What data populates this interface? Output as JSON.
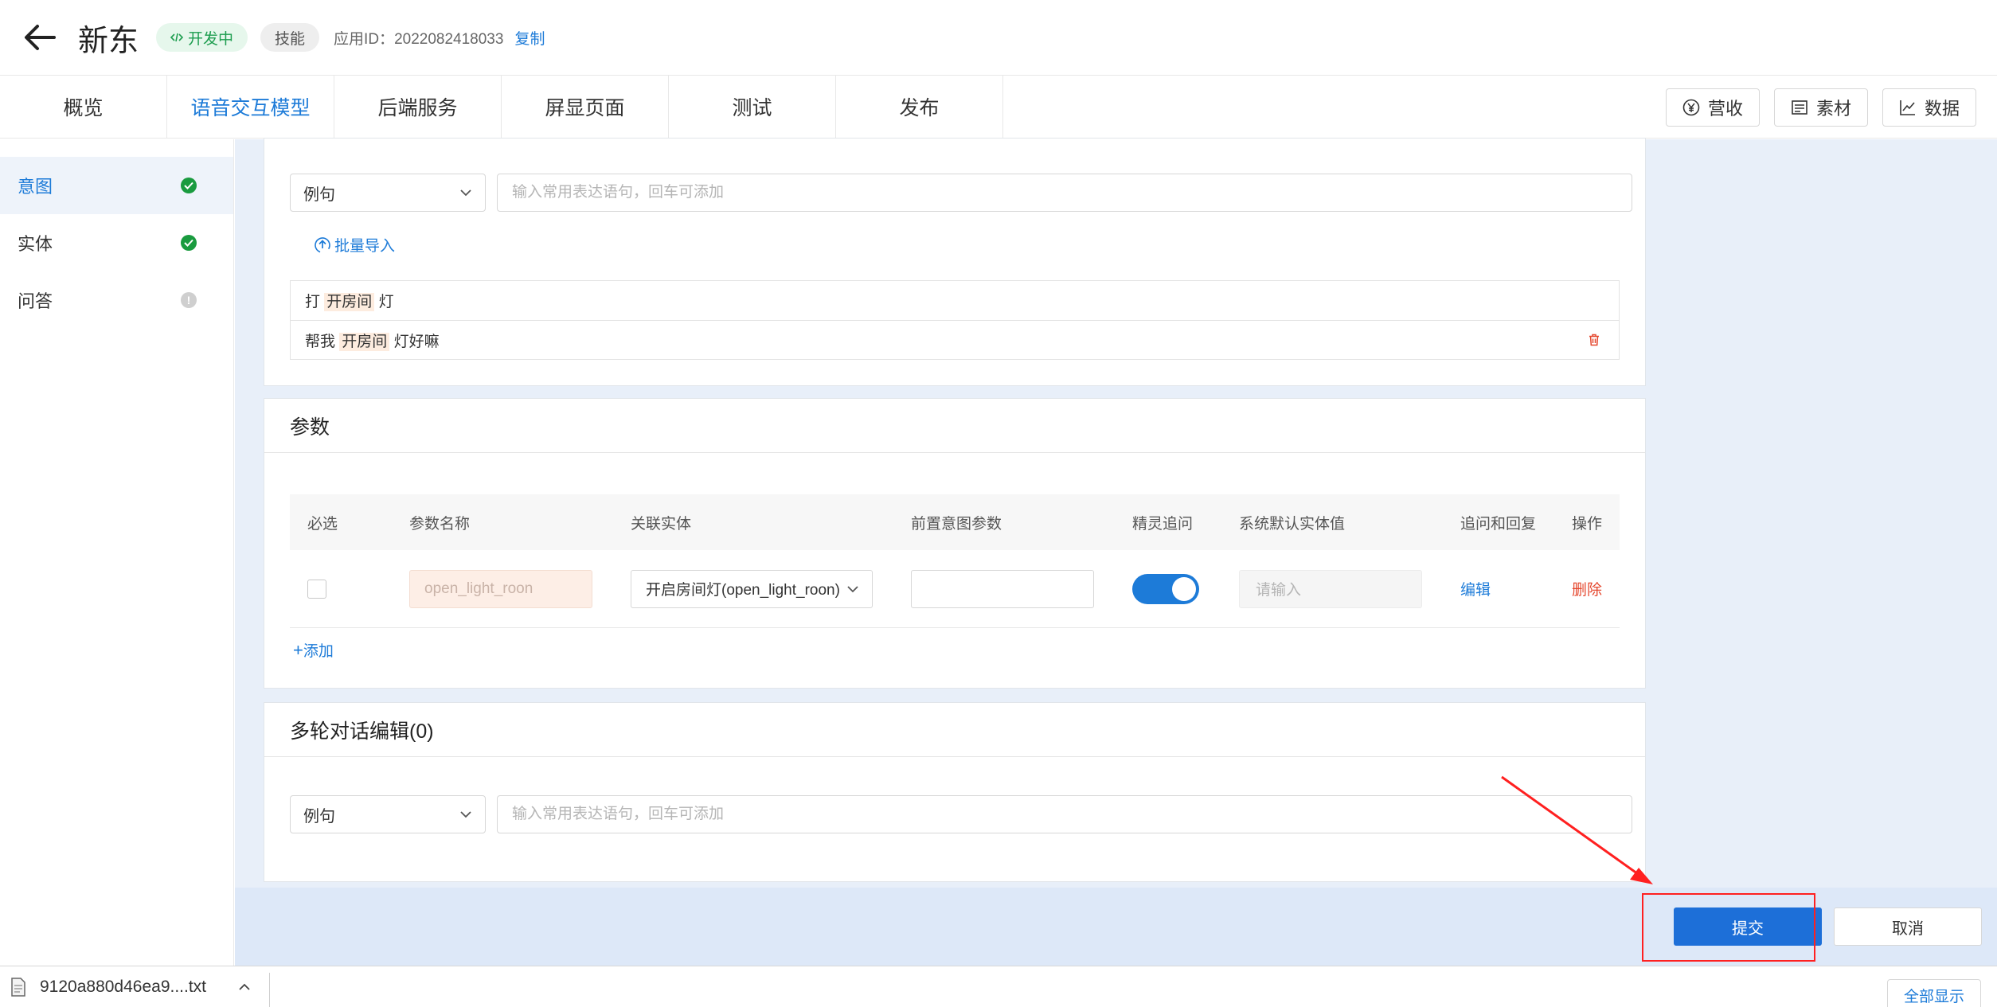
{
  "header": {
    "title": "新东",
    "status": "开发中",
    "type": "技能",
    "app_id_label": "应用ID：",
    "app_id": "2022082418033",
    "copy_label": "复制"
  },
  "tabs": [
    {
      "label": "概览",
      "active": false
    },
    {
      "label": "语音交互模型",
      "active": true
    },
    {
      "label": "后端服务",
      "active": false
    },
    {
      "label": "屏显页面",
      "active": false
    },
    {
      "label": "测试",
      "active": false
    },
    {
      "label": "发布",
      "active": false
    }
  ],
  "toolbar": {
    "revenue": "营收",
    "assets": "素材",
    "data": "数据"
  },
  "sidebar": {
    "items": [
      {
        "label": "意图",
        "state": "done"
      },
      {
        "label": "实体",
        "state": "done"
      },
      {
        "label": "问答",
        "state": "pending"
      }
    ]
  },
  "examples": {
    "select_value": "例句",
    "input_placeholder": "输入常用表达语句，回车可添加",
    "import_label": "批量导入",
    "rows": [
      {
        "pre": "打 ",
        "hl": "开房间",
        "post": " 灯"
      },
      {
        "pre": "帮我 ",
        "hl": "开房间",
        "post": " 灯好嘛"
      }
    ]
  },
  "params": {
    "title": "参数",
    "headers": {
      "required": "必选",
      "name": "参数名称",
      "entity": "关联实体",
      "prev": "前置意图参数",
      "wizard": "精灵追问",
      "default": "系统默认实体值",
      "reply": "追问和回复",
      "op": "操作"
    },
    "row": {
      "name": "open_light_roon",
      "entity": "开启房间灯(open_light_roon)",
      "default_placeholder": "请输入",
      "edit": "编辑",
      "delete": "删除"
    },
    "add_label": "添加"
  },
  "multiturn": {
    "title": "多轮对话编辑(0)",
    "select_value": "例句",
    "input_placeholder": "输入常用表达语句，回车可添加"
  },
  "actions": {
    "submit": "提交",
    "cancel": "取消"
  },
  "downloads": {
    "file": "9120a880d46ea9....txt",
    "show_all": "全部显示"
  },
  "colors": {
    "accent": "#1d7bd8",
    "success": "#1a9b3f",
    "danger": "#e5482f",
    "annotation": "#ff2020"
  }
}
